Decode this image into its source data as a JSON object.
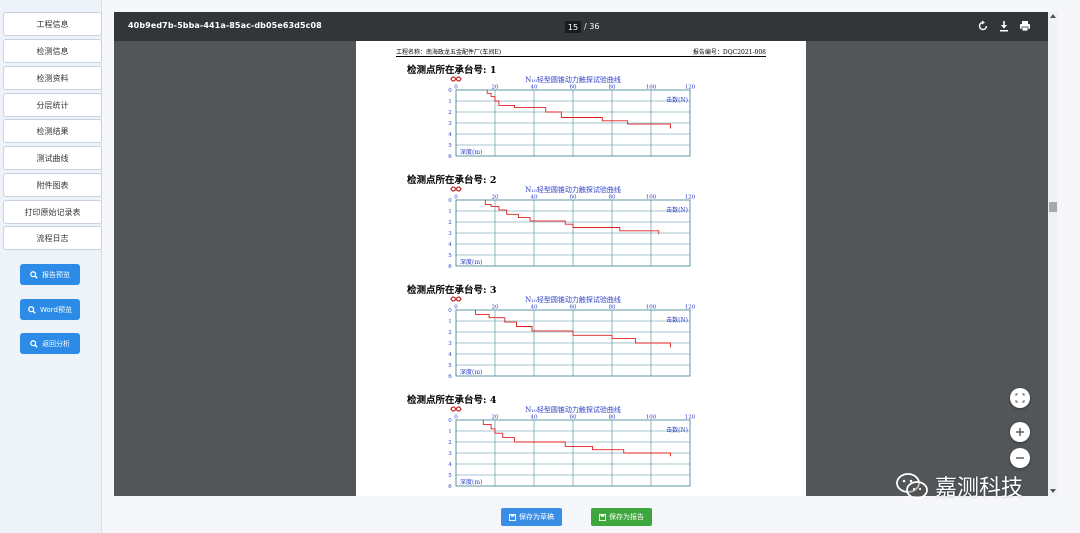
{
  "sidebar": {
    "nav_items": [
      {
        "label": "工程信息"
      },
      {
        "label": "检测信息"
      },
      {
        "label": "检测资料"
      },
      {
        "label": "分层统计"
      },
      {
        "label": "检测结果"
      },
      {
        "label": "测试曲线"
      },
      {
        "label": "附件图表"
      },
      {
        "label": "打印原始记录表"
      },
      {
        "label": "流程日志"
      }
    ],
    "action_buttons": [
      {
        "label": "报告预览",
        "icon": "search-icon"
      },
      {
        "label": "Word预览",
        "icon": "search-icon"
      },
      {
        "label": "返回分析",
        "icon": "search-icon"
      }
    ]
  },
  "viewer": {
    "doc_id": "40b9ed7b-5bba-441a-85ac-db05e63d5c08",
    "current_page": "15",
    "total_pages": "/ 36",
    "icons": [
      "rotate-icon",
      "download-icon",
      "print-icon"
    ]
  },
  "document": {
    "project_name": "工程名称：南海政龙五金配件厂(车间E)",
    "report_no": "报告编号：DQC2021-008",
    "chart_title": "N₁₀轻型圆锥动力触探试验曲线",
    "x_unit_label": "击数(N)",
    "y_unit_label": "深度(m)"
  },
  "chart_data": [
    {
      "section_title": "检测点所在承台号: 1",
      "type": "line",
      "title": "N₁₀轻型圆锥动力触探试验曲线",
      "xlabel": "击数(N)",
      "ylabel": "深度(m)",
      "xticks": [
        0,
        20,
        40,
        60,
        80,
        100,
        120
      ],
      "yticks": [
        0,
        1,
        2,
        3,
        4,
        5,
        6
      ],
      "xlim": [
        0,
        120
      ],
      "ylim": [
        0,
        6
      ],
      "series": [
        {
          "points": [
            [
              16,
              0.0
            ],
            [
              16,
              0.3
            ],
            [
              18,
              0.3
            ],
            [
              18,
              0.6
            ],
            [
              20,
              0.6
            ],
            [
              20,
              1.0
            ],
            [
              22,
              1.0
            ],
            [
              22,
              1.4
            ],
            [
              30,
              1.4
            ],
            [
              30,
              1.6
            ],
            [
              46,
              1.6
            ],
            [
              46,
              2.0
            ],
            [
              54,
              2.0
            ],
            [
              54,
              2.5
            ],
            [
              75,
              2.5
            ],
            [
              75,
              2.8
            ],
            [
              88,
              2.8
            ],
            [
              88,
              3.1
            ],
            [
              110,
              3.1
            ],
            [
              110,
              3.5
            ]
          ]
        }
      ]
    },
    {
      "section_title": "检测点所在承台号: 2",
      "type": "line",
      "title": "N₁₀轻型圆锥动力触探试验曲线",
      "xlabel": "击数(N)",
      "ylabel": "深度(m)",
      "xticks": [
        0,
        20,
        40,
        60,
        80,
        100,
        120
      ],
      "yticks": [
        0,
        1,
        2,
        3,
        4,
        5,
        6
      ],
      "xlim": [
        0,
        120
      ],
      "ylim": [
        0,
        6
      ],
      "series": [
        {
          "points": [
            [
              15,
              0.0
            ],
            [
              15,
              0.4
            ],
            [
              18,
              0.4
            ],
            [
              18,
              0.6
            ],
            [
              22,
              0.6
            ],
            [
              22,
              0.9
            ],
            [
              26,
              0.9
            ],
            [
              26,
              1.3
            ],
            [
              32,
              1.3
            ],
            [
              32,
              1.6
            ],
            [
              38,
              1.6
            ],
            [
              38,
              1.9
            ],
            [
              56,
              1.9
            ],
            [
              56,
              2.2
            ],
            [
              60,
              2.2
            ],
            [
              60,
              2.5
            ],
            [
              84,
              2.5
            ],
            [
              84,
              2.8
            ],
            [
              104,
              2.8
            ],
            [
              104,
              3.1
            ]
          ]
        }
      ]
    },
    {
      "section_title": "检测点所在承台号: 3",
      "type": "line",
      "title": "N₁₀轻型圆锥动力触探试验曲线",
      "xlabel": "击数(N)",
      "ylabel": "深度(m)",
      "xticks": [
        0,
        20,
        40,
        60,
        80,
        100,
        120
      ],
      "yticks": [
        0,
        1,
        2,
        3,
        4,
        5,
        6
      ],
      "xlim": [
        0,
        120
      ],
      "ylim": [
        0,
        6
      ],
      "series": [
        {
          "points": [
            [
              10,
              0.0
            ],
            [
              10,
              0.4
            ],
            [
              17,
              0.4
            ],
            [
              17,
              0.7
            ],
            [
              25,
              0.7
            ],
            [
              25,
              1.1
            ],
            [
              31,
              1.1
            ],
            [
              31,
              1.5
            ],
            [
              39,
              1.5
            ],
            [
              39,
              1.9
            ],
            [
              60,
              1.9
            ],
            [
              60,
              2.3
            ],
            [
              80,
              2.3
            ],
            [
              80,
              2.6
            ],
            [
              92,
              2.6
            ],
            [
              92,
              3.0
            ],
            [
              110,
              3.0
            ],
            [
              110,
              3.4
            ]
          ]
        }
      ]
    },
    {
      "section_title": "检测点所在承台号: 4",
      "type": "line",
      "title": "N₁₀轻型圆锥动力触探试验曲线",
      "xlabel": "击数(N)",
      "ylabel": "深度(m)",
      "xticks": [
        0,
        20,
        40,
        60,
        80,
        100,
        120
      ],
      "yticks": [
        0,
        1,
        2,
        3,
        4,
        5,
        6
      ],
      "xlim": [
        0,
        120
      ],
      "ylim": [
        0,
        6
      ],
      "series": [
        {
          "points": [
            [
              14,
              0.0
            ],
            [
              14,
              0.4
            ],
            [
              18,
              0.4
            ],
            [
              18,
              0.8
            ],
            [
              20,
              0.8
            ],
            [
              20,
              1.2
            ],
            [
              24,
              1.2
            ],
            [
              24,
              1.6
            ],
            [
              30,
              1.6
            ],
            [
              30,
              2.0
            ],
            [
              56,
              2.0
            ],
            [
              56,
              2.4
            ],
            [
              70,
              2.4
            ],
            [
              70,
              2.7
            ],
            [
              86,
              2.7
            ],
            [
              86,
              3.0
            ],
            [
              110,
              3.0
            ],
            [
              110,
              3.3
            ]
          ]
        }
      ]
    }
  ],
  "bottom_bar": {
    "save_draft_label": "保存为草稿",
    "save_report_label": "保存为报告",
    "colors": {
      "draft": "#3a8ee6",
      "report": "#3da63d"
    }
  },
  "watermark": {
    "text": "嘉测科技",
    "icon": "wechat-icon"
  },
  "zoom": {
    "fit_icon": "fit-icon",
    "zoom_in_icon": "plus-icon",
    "zoom_out_icon": "minus-icon"
  }
}
